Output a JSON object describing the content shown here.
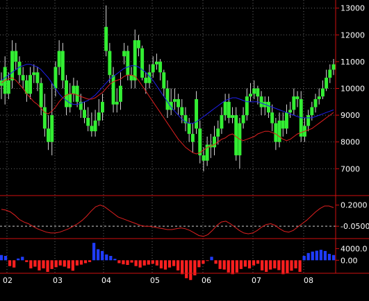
{
  "colors": {
    "background": "#000000",
    "grid": "#6a6a6a",
    "candle_body": "#33ee33",
    "candle_wick": "#d8d8d8",
    "ma_short": "#e02020",
    "ma_long": "#2020ee",
    "osc_line": "#e02020",
    "hist_pos": "#1f3cff",
    "hist_neg": "#ff1f1f",
    "axis_text": "#ffffff",
    "panel_border": "#d01010"
  },
  "chart_data": [
    {
      "type": "candlestick",
      "name": "price",
      "ylim": [
        6100,
        13200
      ],
      "yticks": [
        7000,
        8000,
        9000,
        10000,
        11000,
        12000,
        13000
      ],
      "ytick_labels": [
        "7000",
        "8000",
        "9000",
        "10000",
        "11000",
        "12000",
        "13000"
      ],
      "x_labels": [
        "02",
        "03",
        "04",
        "05",
        "06",
        "07",
        "08"
      ],
      "grid": true,
      "n": 79,
      "open": [
        10300,
        10800,
        9800,
        10300,
        11400,
        11000,
        10500,
        10300,
        9800,
        10500,
        10600,
        10200,
        9300,
        8500,
        8000,
        10000,
        10800,
        11400,
        10300,
        9300,
        9800,
        10100,
        9500,
        9200,
        8900,
        8600,
        8400,
        8800,
        9100,
        12300,
        11400,
        10500,
        9400,
        9500,
        11200,
        11400,
        10500,
        10300,
        11800,
        11500,
        10400,
        10200,
        10600,
        10900,
        11000,
        10600,
        10000,
        9200,
        9500,
        9600,
        9300,
        9000,
        8700,
        8300,
        9600,
        8500,
        7500,
        7300,
        7900,
        7800,
        8200,
        8500,
        9000,
        9500,
        8900,
        9000,
        7500,
        8700,
        9000,
        9700,
        9800,
        10000,
        9700,
        9300,
        9500,
        9100,
        8700,
        8000,
        8800,
        8500,
        9100,
        9200,
        9700,
        9600,
        8200,
        8600,
        9000,
        9300,
        9600,
        9700,
        10000,
        10400,
        10700
      ],
      "close": [
        10100,
        9800,
        10300,
        11400,
        11000,
        10500,
        10300,
        9800,
        10500,
        10600,
        10200,
        9300,
        8500,
        8000,
        9000,
        10800,
        11400,
        10300,
        9300,
        9800,
        10100,
        9500,
        9200,
        8900,
        8600,
        8400,
        8800,
        9100,
        9500,
        11400,
        10500,
        9400,
        9500,
        10100,
        11400,
        10500,
        10300,
        11800,
        11500,
        10400,
        10200,
        10600,
        10900,
        11000,
        10600,
        10000,
        9200,
        9500,
        9600,
        9300,
        9000,
        8700,
        8300,
        8000,
        8500,
        7500,
        7300,
        7900,
        7800,
        8200,
        8500,
        9000,
        9500,
        8900,
        9000,
        7500,
        8700,
        9000,
        9700,
        9800,
        10000,
        9700,
        9300,
        9500,
        9100,
        8700,
        8000,
        8800,
        8500,
        9100,
        9200,
        9700,
        9600,
        8200,
        8600,
        9000,
        9300,
        9600,
        9700,
        10000,
        10400,
        10700,
        10900
      ],
      "high": [
        10600,
        11200,
        10600,
        11800,
        11700,
        11200,
        10800,
        10500,
        10800,
        10900,
        10800,
        10400,
        9800,
        9000,
        10200,
        11000,
        11800,
        11700,
        10500,
        10200,
        10400,
        10300,
        9800,
        9500,
        9300,
        9100,
        9200,
        9600,
        9800,
        13100,
        11700,
        10800,
        10000,
        10600,
        11700,
        11600,
        10800,
        12200,
        12000,
        11600,
        10600,
        10900,
        11200,
        11300,
        11100,
        10700,
        10300,
        10000,
        10000,
        9800,
        9600,
        9300,
        8900,
        8700,
        9900,
        8800,
        7800,
        8200,
        8300,
        8600,
        8800,
        9300,
        9800,
        9800,
        9300,
        9300,
        8900,
        9300,
        10000,
        10200,
        10300,
        10100,
        9900,
        9700,
        9700,
        9400,
        8900,
        9100,
        9100,
        9400,
        9500,
        10000,
        9900,
        9900,
        8900,
        9200,
        9500,
        9800,
        10000,
        10300,
        10700,
        10900,
        11100
      ],
      "low": [
        9600,
        9400,
        9600,
        10000,
        10700,
        10200,
        10000,
        9500,
        9600,
        10200,
        9900,
        9000,
        8200,
        7700,
        7500,
        9700,
        10500,
        10000,
        9000,
        9100,
        9500,
        9300,
        8900,
        8700,
        8400,
        8200,
        8200,
        8600,
        8800,
        11200,
        10200,
        9100,
        9100,
        9200,
        10900,
        10300,
        10000,
        10000,
        11200,
        10300,
        9800,
        10000,
        10400,
        10700,
        10300,
        9700,
        8900,
        9000,
        9200,
        9000,
        8700,
        8400,
        8000,
        7600,
        8300,
        7200,
        6900,
        7100,
        7400,
        7500,
        7900,
        8300,
        8800,
        8700,
        8700,
        7300,
        7000,
        8500,
        8800,
        9500,
        9600,
        9400,
        9000,
        9000,
        8900,
        8400,
        7700,
        7800,
        8200,
        8300,
        8900,
        9000,
        9300,
        8000,
        8000,
        8400,
        8800,
        9100,
        9400,
        9600,
        9900,
        10200,
        10500
      ],
      "ma_short": [
        10200,
        10300,
        10350,
        10400,
        10300,
        10150,
        10000,
        9800,
        9650,
        9500,
        9400,
        9250,
        9100,
        9050,
        9150,
        9300,
        9500,
        9650,
        9750,
        9800,
        9800,
        9750,
        9700,
        9650,
        9600,
        9600,
        9650,
        9750,
        9850,
        10000,
        10150,
        10250,
        10300,
        10350,
        10450,
        10500,
        10500,
        10450,
        10300,
        10100,
        9900,
        9700,
        9500,
        9300,
        9100,
        8900,
        8700,
        8500,
        8300,
        8100,
        7950,
        7800,
        7700,
        7600,
        7550,
        7600,
        7700,
        7800,
        7850,
        7900,
        8000,
        8100,
        8150,
        8250,
        8300,
        8200,
        8100,
        8050,
        8100,
        8150,
        8200,
        8300,
        8350,
        8400,
        8400,
        8350,
        8300,
        8200,
        8100,
        8050,
        8100,
        8200,
        8300,
        8350,
        8400,
        8450,
        8500,
        8600,
        8700,
        8800,
        8900,
        9000,
        9100
      ],
      "ma_long": [
        10300,
        10400,
        10500,
        10600,
        10700,
        10800,
        10850,
        10900,
        10900,
        10850,
        10800,
        10700,
        10550,
        10400,
        10200,
        10000,
        9800,
        9650,
        9550,
        9450,
        9400,
        9400,
        9450,
        9500,
        9550,
        9650,
        9750,
        9900,
        10050,
        10200,
        10350,
        10450,
        10550,
        10650,
        10750,
        10800,
        10850,
        10850,
        10800,
        10700,
        10600,
        10450,
        10300,
        10100,
        9900,
        9700,
        9500,
        9300,
        9150,
        9000,
        8850,
        8750,
        8700,
        8700,
        8750,
        8850,
        8950,
        9050,
        9150,
        9250,
        9350,
        9450,
        9550,
        9600,
        9650,
        9650,
        9600,
        9550,
        9500,
        9500,
        9500,
        9500,
        9450,
        9400,
        9350,
        9300,
        9250,
        9200,
        9150,
        9100,
        9050,
        9000,
        8950,
        8900,
        8900,
        8900,
        8900,
        8950,
        9000,
        9050,
        9100,
        9150,
        9200
      ]
    },
    {
      "type": "line",
      "name": "oscillator",
      "ylim": [
        -0.18,
        0.28
      ],
      "yticks": [
        0.2,
        -0.05
      ],
      "ytick_labels": [
        "0.2000",
        "-0.0500"
      ],
      "reference": -0.05,
      "values": [
        0.15,
        0.14,
        0.12,
        0.08,
        0.03,
        0.0,
        -0.02,
        -0.05,
        -0.08,
        -0.1,
        -0.12,
        -0.13,
        -0.13,
        -0.12,
        -0.1,
        -0.08,
        -0.05,
        -0.02,
        0.02,
        0.07,
        0.13,
        0.18,
        0.2,
        0.18,
        0.14,
        0.1,
        0.06,
        0.04,
        0.02,
        0.0,
        -0.02,
        -0.04,
        -0.05,
        -0.05,
        -0.06,
        -0.07,
        -0.08,
        -0.09,
        -0.09,
        -0.08,
        -0.07,
        -0.08,
        -0.1,
        -0.13,
        -0.16,
        -0.17,
        -0.15,
        -0.1,
        -0.04,
        0.0,
        0.01,
        -0.02,
        -0.06,
        -0.1,
        -0.13,
        -0.14,
        -0.13,
        -0.1,
        -0.06,
        -0.03,
        -0.02,
        -0.04,
        -0.08,
        -0.11,
        -0.12,
        -0.1,
        -0.06,
        -0.02,
        0.02,
        0.07,
        0.12,
        0.16,
        0.19,
        0.19,
        0.17
      ]
    },
    {
      "type": "bar",
      "name": "histogram",
      "ylim": [
        -4000,
        7000
      ],
      "yticks": [
        4000,
        0
      ],
      "ytick_labels": [
        "4000.0",
        "0.00"
      ],
      "values": [
        1800,
        1500,
        -2000,
        -2500,
        600,
        1200,
        -600,
        -2800,
        -2200,
        -3500,
        -2800,
        -4000,
        -3000,
        -2400,
        -1800,
        -2200,
        -2800,
        -3600,
        -1800,
        -1500,
        -1000,
        -600,
        6000,
        3800,
        3200,
        2000,
        1500,
        500,
        -1000,
        -1400,
        -1600,
        -800,
        -2000,
        -2500,
        -1800,
        -1500,
        -1200,
        -1800,
        -2800,
        -3200,
        -2500,
        -2000,
        -3500,
        -4800,
        -6200,
        -6800,
        -5200,
        -2400,
        -1200,
        -200,
        1200,
        -1200,
        -3000,
        -3200,
        -4200,
        -4800,
        -4200,
        -3000,
        -2200,
        -2800,
        -1800,
        -1200,
        -3500,
        -4000,
        -3200,
        -2800,
        -3400,
        -4800,
        -4500,
        -3600,
        -2800,
        -4000,
        1500,
        2500,
        3000,
        3300,
        3600,
        3200,
        2200,
        1800
      ]
    }
  ]
}
